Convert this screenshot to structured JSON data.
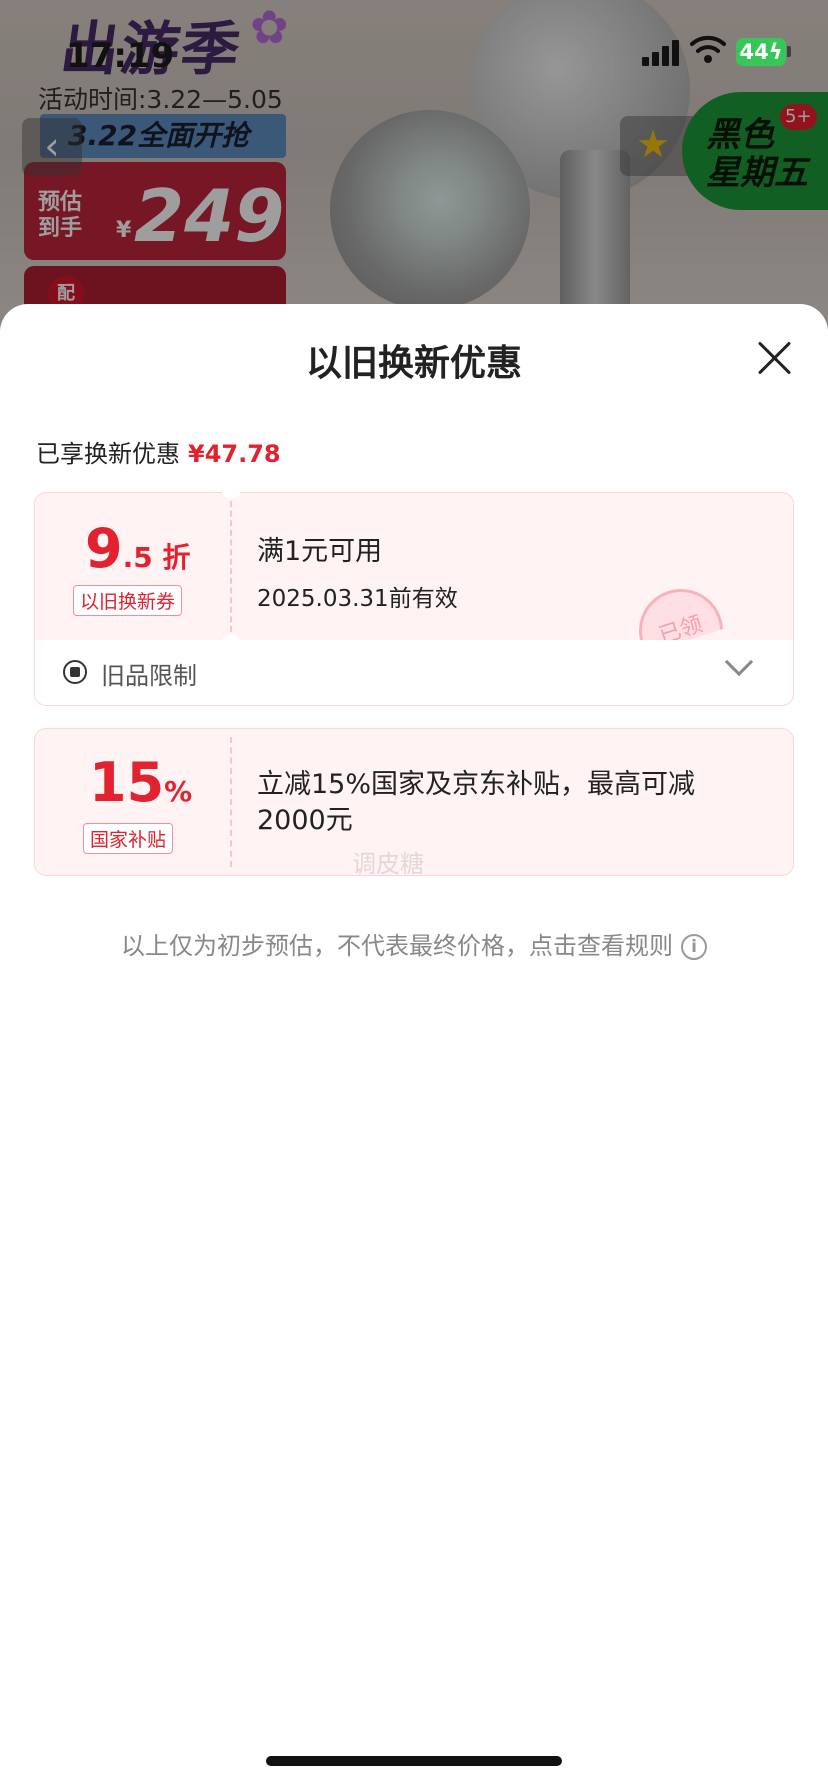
{
  "status_bar": {
    "time": "17:19",
    "battery": "44"
  },
  "background": {
    "promo_title": "出游季",
    "promo_time": "活动时间:3.22—5.05",
    "promo_ribbon": "3.22全面开抢",
    "price_label_line1": "预估",
    "price_label_line2": "到手",
    "price_currency": "¥",
    "price_value": "249",
    "badge_text_line1": "黑色",
    "badge_text_line2": "星期五",
    "cart_count": "5+"
  },
  "sheet": {
    "title": "以旧换新优惠",
    "saved_label": "已享换新优惠",
    "saved_amount": "¥47.78",
    "coupon1": {
      "discount_int": "9",
      "discount_frac": ".5 折",
      "tag": "以旧换新券",
      "condition": "满1元可用",
      "expiry": "2025.03.31前有效",
      "stamp": "已领",
      "restriction_label": "旧品限制"
    },
    "coupon2": {
      "discount_int": "15",
      "discount_unit": "%",
      "tag": "国家补贴",
      "description": "立减15%国家及京东补贴，最高可减 2000元"
    },
    "watermark": "调皮糖",
    "disclaimer": "以上仅为初步预估，不代表最终价格，点击查看规则"
  },
  "colors": {
    "accent_red": "#e3222f",
    "coupon_bg": "#fff3f4",
    "battery_green": "#37c759"
  }
}
